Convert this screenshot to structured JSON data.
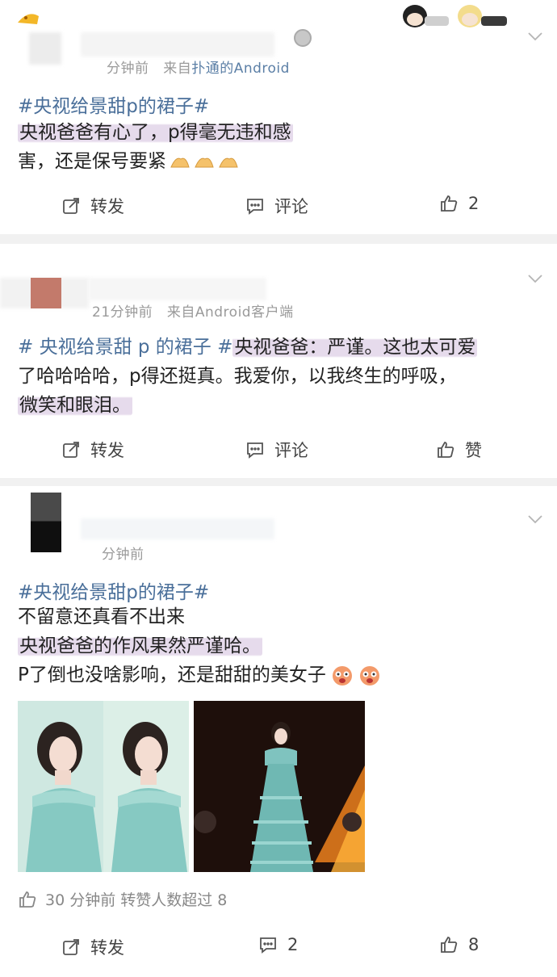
{
  "posts": [
    {
      "meta_time": "分钟前",
      "meta_from": "来自",
      "meta_source": "扑通的Android",
      "hashtag": "#央视给景甜p的裙子#",
      "body_lines": [
        "央视爸爸有心了，p得毫无违和感",
        "害，还是保号要紧"
      ],
      "repost_label": "转发",
      "comment_label": "评论",
      "like_count": "2"
    },
    {
      "meta_time": "21分钟前",
      "meta_from": "来自",
      "meta_source": "Android客户端",
      "hashtag": "# 央视给景甜 p 的裙子 #",
      "body_lines": [
        "央视爸爸：严谨。这也太可爱",
        "了哈哈哈哈，p得还挺真。我爱你，以我终生的呼吸，",
        "微笑和眼泪。"
      ],
      "repost_label": "转发",
      "comment_label": "评论",
      "like_label": "赞"
    },
    {
      "meta_time": "分钟前",
      "hashtag": "#央视给景甜p的裙子#",
      "body_lines": [
        "不留意还真看不出来",
        "央视爸爸的作风果然严谨哈。",
        "P了倒也没啥影响，还是甜甜的美女子"
      ],
      "footer_info": "30 分钟前  转赞人数超过 8",
      "repost_label": "转发",
      "comment_count": "2",
      "like_count": "8"
    }
  ],
  "colors": {
    "hashtag": "#4a6f9a",
    "highlight": "#e6dbec",
    "dress": "#7fc3bf",
    "stage": "#2a1410"
  },
  "icons": [
    "chevron-down-icon",
    "repost-icon",
    "comment-icon",
    "like-icon",
    "clap-emoji-icon",
    "laugh-emoji-icon"
  ]
}
